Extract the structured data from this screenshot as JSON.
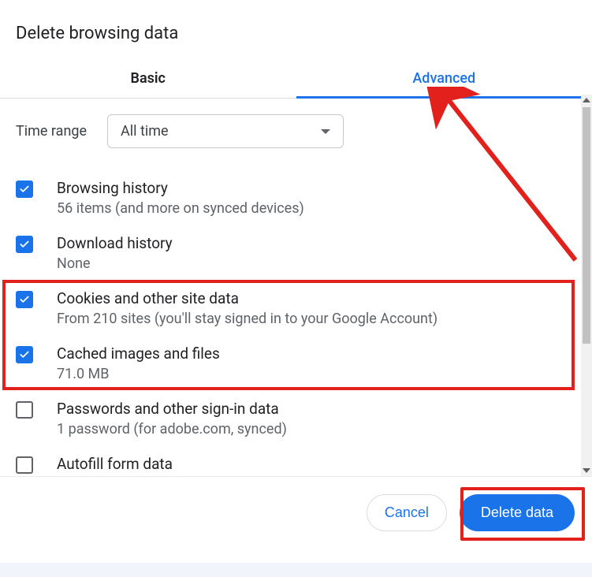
{
  "title": "Delete browsing data",
  "tabs": {
    "basic": "Basic",
    "advanced": "Advanced"
  },
  "time": {
    "label": "Time range",
    "selected": "All time"
  },
  "options": [
    {
      "title": "Browsing history",
      "sub": "56 items (and more on synced devices)",
      "checked": true
    },
    {
      "title": "Download history",
      "sub": "None",
      "checked": true
    },
    {
      "title": "Cookies and other site data",
      "sub": "From 210 sites (you'll stay signed in to your Google Account)",
      "checked": true
    },
    {
      "title": "Cached images and files",
      "sub": "71.0 MB",
      "checked": true
    },
    {
      "title": "Passwords and other sign-in data",
      "sub": "1 password (for adobe.com, synced)",
      "checked": false
    },
    {
      "title": "Autofill form data",
      "sub": "",
      "checked": false
    }
  ],
  "actions": {
    "cancel": "Cancel",
    "delete": "Delete data"
  }
}
